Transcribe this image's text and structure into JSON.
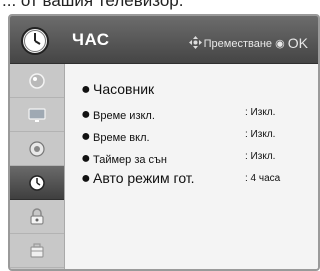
{
  "background_caption": "... от вашия телевизор.",
  "header": {
    "title": "ЧАС",
    "hint": "Преместване",
    "hint_ok": "OK"
  },
  "sidebar": {
    "items": [
      {
        "icon": "picture-icon",
        "active": false
      },
      {
        "icon": "monitor-icon",
        "active": false
      },
      {
        "icon": "audio-icon",
        "active": false
      },
      {
        "icon": "clock-icon",
        "active": true
      },
      {
        "icon": "lock-icon",
        "active": false
      },
      {
        "icon": "options-icon",
        "active": false
      }
    ]
  },
  "menu": {
    "rows": [
      {
        "label": "Часовник",
        "value": ""
      },
      {
        "label": "Време изкл.",
        "value": ": Изкл."
      },
      {
        "label": "Време вкл.",
        "value": ": Изкл."
      },
      {
        "label": "Таймер за сън",
        "value": ": Изкл."
      },
      {
        "label": "Авто режим гот.",
        "value": ": 4 часа"
      }
    ]
  },
  "colors": {
    "header": "#4e4e4e",
    "content": "#f4f4f4",
    "sidebar": "#c8c8c8",
    "active_item": "#4a4a4a"
  }
}
